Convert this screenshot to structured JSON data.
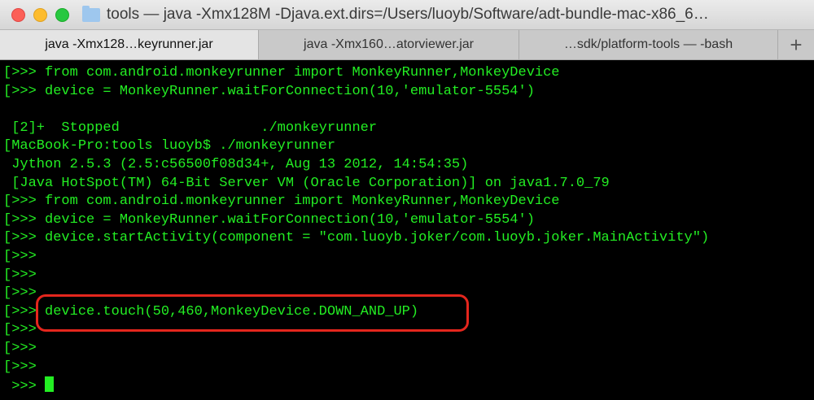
{
  "window": {
    "title": "tools — java -Xmx128M -Djava.ext.dirs=/Users/luoyb/Software/adt-bundle-mac-x86_6…"
  },
  "tabs": [
    {
      "label": "java -Xmx128…keyrunner.jar",
      "active": true
    },
    {
      "label": "java -Xmx160…atorviewer.jar",
      "active": false
    },
    {
      "label": "…sdk/platform-tools — -bash",
      "active": false
    }
  ],
  "tab_add_label": "+",
  "terminal": {
    "lines": [
      "[>>> from com.android.monkeyrunner import MonkeyRunner,MonkeyDevice",
      "[>>> device = MonkeyRunner.waitForConnection(10,'emulator-5554')",
      "",
      " [2]+  Stopped                 ./monkeyrunner",
      "[MacBook-Pro:tools luoyb$ ./monkeyrunner",
      " Jython 2.5.3 (2.5:c56500f08d34+, Aug 13 2012, 14:54:35)",
      " [Java HotSpot(TM) 64-Bit Server VM (Oracle Corporation)] on java1.7.0_79",
      "[>>> from com.android.monkeyrunner import MonkeyRunner,MonkeyDevice",
      "[>>> device = MonkeyRunner.waitForConnection(10,'emulator-5554')",
      "[>>> device.startActivity(component = \"com.luoyb.joker/com.luoyb.joker.MainActivity\")",
      "[>>>",
      "[>>>",
      "[>>>",
      "[>>> device.touch(50,460,MonkeyDevice.DOWN_AND_UP)",
      "[>>>",
      "[>>>",
      "[>>>"
    ],
    "prompt": " >>> "
  },
  "colors": {
    "terminal_text": "#23ee23",
    "terminal_bg": "#000000",
    "highlight": "#e5261d"
  }
}
